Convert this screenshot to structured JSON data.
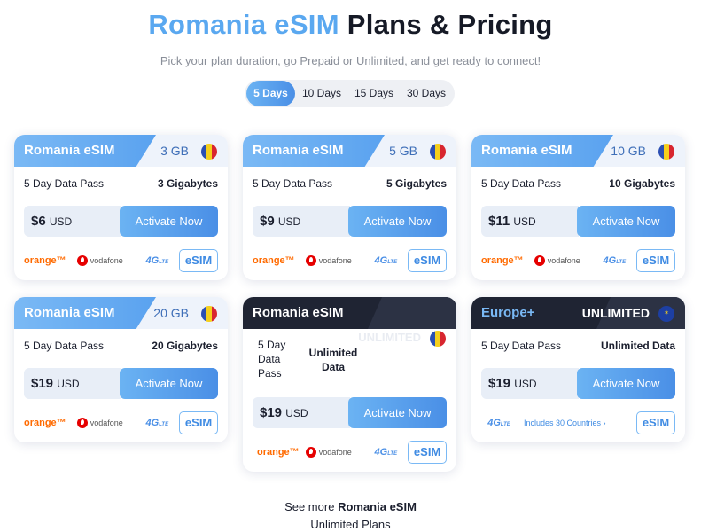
{
  "heading": {
    "accent": "Romania eSIM",
    "rest": "Plans & Pricing"
  },
  "subtitle": "Pick your plan duration, go Prepaid or Unlimited, and get ready to connect!",
  "tabs": [
    {
      "label": "5 Days",
      "active": true
    },
    {
      "label": "10 Days",
      "active": false
    },
    {
      "label": "15 Days",
      "active": false
    },
    {
      "label": "30 Days",
      "active": false
    }
  ],
  "plans": [
    {
      "name": "Romania eSIM",
      "size": "3 GB",
      "duration": "5 Day Data Pass",
      "data": "3 Gigabytes",
      "price": "$6",
      "currency": "USD",
      "cta": "Activate Now"
    },
    {
      "name": "Romania eSIM",
      "size": "5 GB",
      "duration": "5 Day Data Pass",
      "data": "5 Gigabytes",
      "price": "$9",
      "currency": "USD",
      "cta": "Activate Now"
    },
    {
      "name": "Romania eSIM",
      "size": "10 GB",
      "duration": "5 Day Data Pass",
      "data": "10 Gigabytes",
      "price": "$11",
      "currency": "USD",
      "cta": "Activate Now"
    },
    {
      "name": "Romania eSIM",
      "size": "20 GB",
      "duration": "5 Day Data Pass",
      "data": "20 Gigabytes",
      "price": "$19",
      "currency": "USD",
      "cta": "Activate Now"
    },
    {
      "name": "Romania eSIM",
      "size": "UNLIMITED",
      "duration": "5 Day Data Pass",
      "data": "Unlimited Data",
      "price": "$19",
      "currency": "USD",
      "cta": "Activate Now"
    },
    {
      "name": "Europe+",
      "size": "UNLIMITED",
      "duration": "5 Day Data Pass",
      "data": "Unlimited Data",
      "price": "$19",
      "currency": "USD",
      "cta": "Activate Now",
      "countries": "Includes 30 Countries ›"
    }
  ],
  "logos": {
    "orange": "orange™",
    "vodafone": "vodafone",
    "lte": "4G",
    "lte_sub": "LTE",
    "esim": "eSIM"
  },
  "footer": {
    "prefix": "See more",
    "bold": "Romania eSIM",
    "line2": "Unlimited Plans"
  },
  "colors": {
    "accent": "#5aa8f0",
    "button": "#4a8fe6",
    "dark": "#1f2433"
  }
}
